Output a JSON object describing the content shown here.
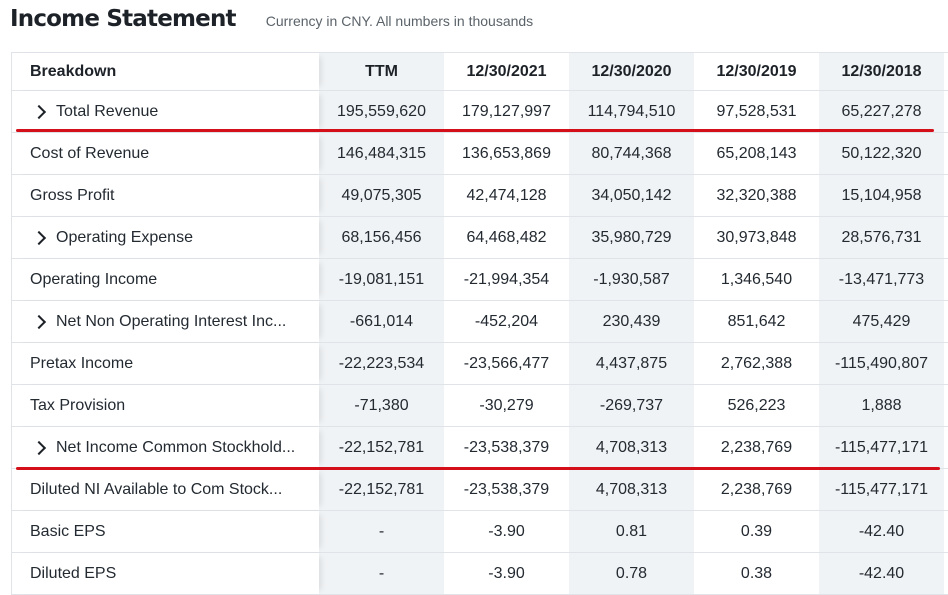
{
  "header": {
    "title": "Income Statement",
    "subtitle": "Currency in CNY. All numbers in thousands"
  },
  "columns": [
    "Breakdown",
    "TTM",
    "12/30/2021",
    "12/30/2020",
    "12/30/2019",
    "12/30/2018"
  ],
  "rows": [
    {
      "label": "Total Revenue",
      "expandable": true,
      "values": [
        "195,559,620",
        "179,127,997",
        "114,794,510",
        "97,528,531",
        "65,227,278"
      ]
    },
    {
      "label": "Cost of Revenue",
      "expandable": false,
      "values": [
        "146,484,315",
        "136,653,869",
        "80,744,368",
        "65,208,143",
        "50,122,320"
      ]
    },
    {
      "label": "Gross Profit",
      "expandable": false,
      "values": [
        "49,075,305",
        "42,474,128",
        "34,050,142",
        "32,320,388",
        "15,104,958"
      ]
    },
    {
      "label": "Operating Expense",
      "expandable": true,
      "values": [
        "68,156,456",
        "64,468,482",
        "35,980,729",
        "30,973,848",
        "28,576,731"
      ]
    },
    {
      "label": "Operating Income",
      "expandable": false,
      "values": [
        "-19,081,151",
        "-21,994,354",
        "-1,930,587",
        "1,346,540",
        "-13,471,773"
      ]
    },
    {
      "label": "Net Non Operating Interest Inc...",
      "expandable": true,
      "values": [
        "-661,014",
        "-452,204",
        "230,439",
        "851,642",
        "475,429"
      ]
    },
    {
      "label": "Pretax Income",
      "expandable": false,
      "values": [
        "-22,223,534",
        "-23,566,477",
        "4,437,875",
        "2,762,388",
        "-115,490,807"
      ]
    },
    {
      "label": "Tax Provision",
      "expandable": false,
      "values": [
        "-71,380",
        "-30,279",
        "-269,737",
        "526,223",
        "1,888"
      ]
    },
    {
      "label": "Net Income Common Stockhold...",
      "expandable": true,
      "values": [
        "-22,152,781",
        "-23,538,379",
        "4,708,313",
        "2,238,769",
        "-115,477,171"
      ]
    },
    {
      "label": "Diluted NI Available to Com Stock...",
      "expandable": false,
      "values": [
        "-22,152,781",
        "-23,538,379",
        "4,708,313",
        "2,238,769",
        "-115,477,171"
      ]
    },
    {
      "label": "Basic EPS",
      "expandable": false,
      "values": [
        "-",
        "-3.90",
        "0.81",
        "0.39",
        "-42.40"
      ]
    },
    {
      "label": "Diluted EPS",
      "expandable": false,
      "values": [
        "-",
        "-3.90",
        "0.78",
        "0.38",
        "-42.40"
      ]
    }
  ],
  "colors": {
    "annotation_line": "#d40f19",
    "alt_column": "#f0f3f5"
  }
}
